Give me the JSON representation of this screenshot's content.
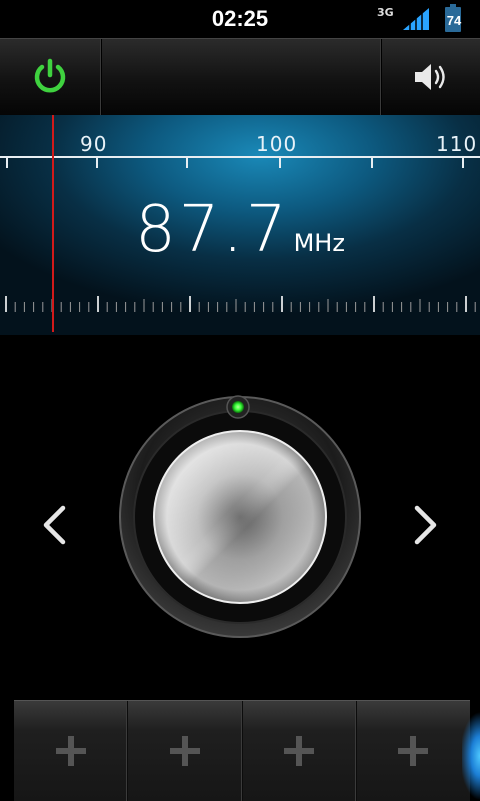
{
  "status_bar": {
    "time": "02:25",
    "network_type": "3G",
    "battery_level": "74"
  },
  "toolbar": {
    "power_icon": "power-icon",
    "power_color": "#3fd23f",
    "speaker_icon": "speaker-icon"
  },
  "tuner": {
    "scale_labels": [
      "90",
      "100",
      "110"
    ],
    "frequency": "87.7",
    "unit": "MHz",
    "needle_color": "#d21a1a"
  },
  "controls": {
    "prev_icon": "chevron-left-icon",
    "next_icon": "chevron-right-icon",
    "knob_indicator_color": "#3bff3b"
  },
  "presets": [
    {
      "icon": "plus-icon"
    },
    {
      "icon": "plus-icon"
    },
    {
      "icon": "plus-icon"
    },
    {
      "icon": "plus-icon"
    }
  ]
}
